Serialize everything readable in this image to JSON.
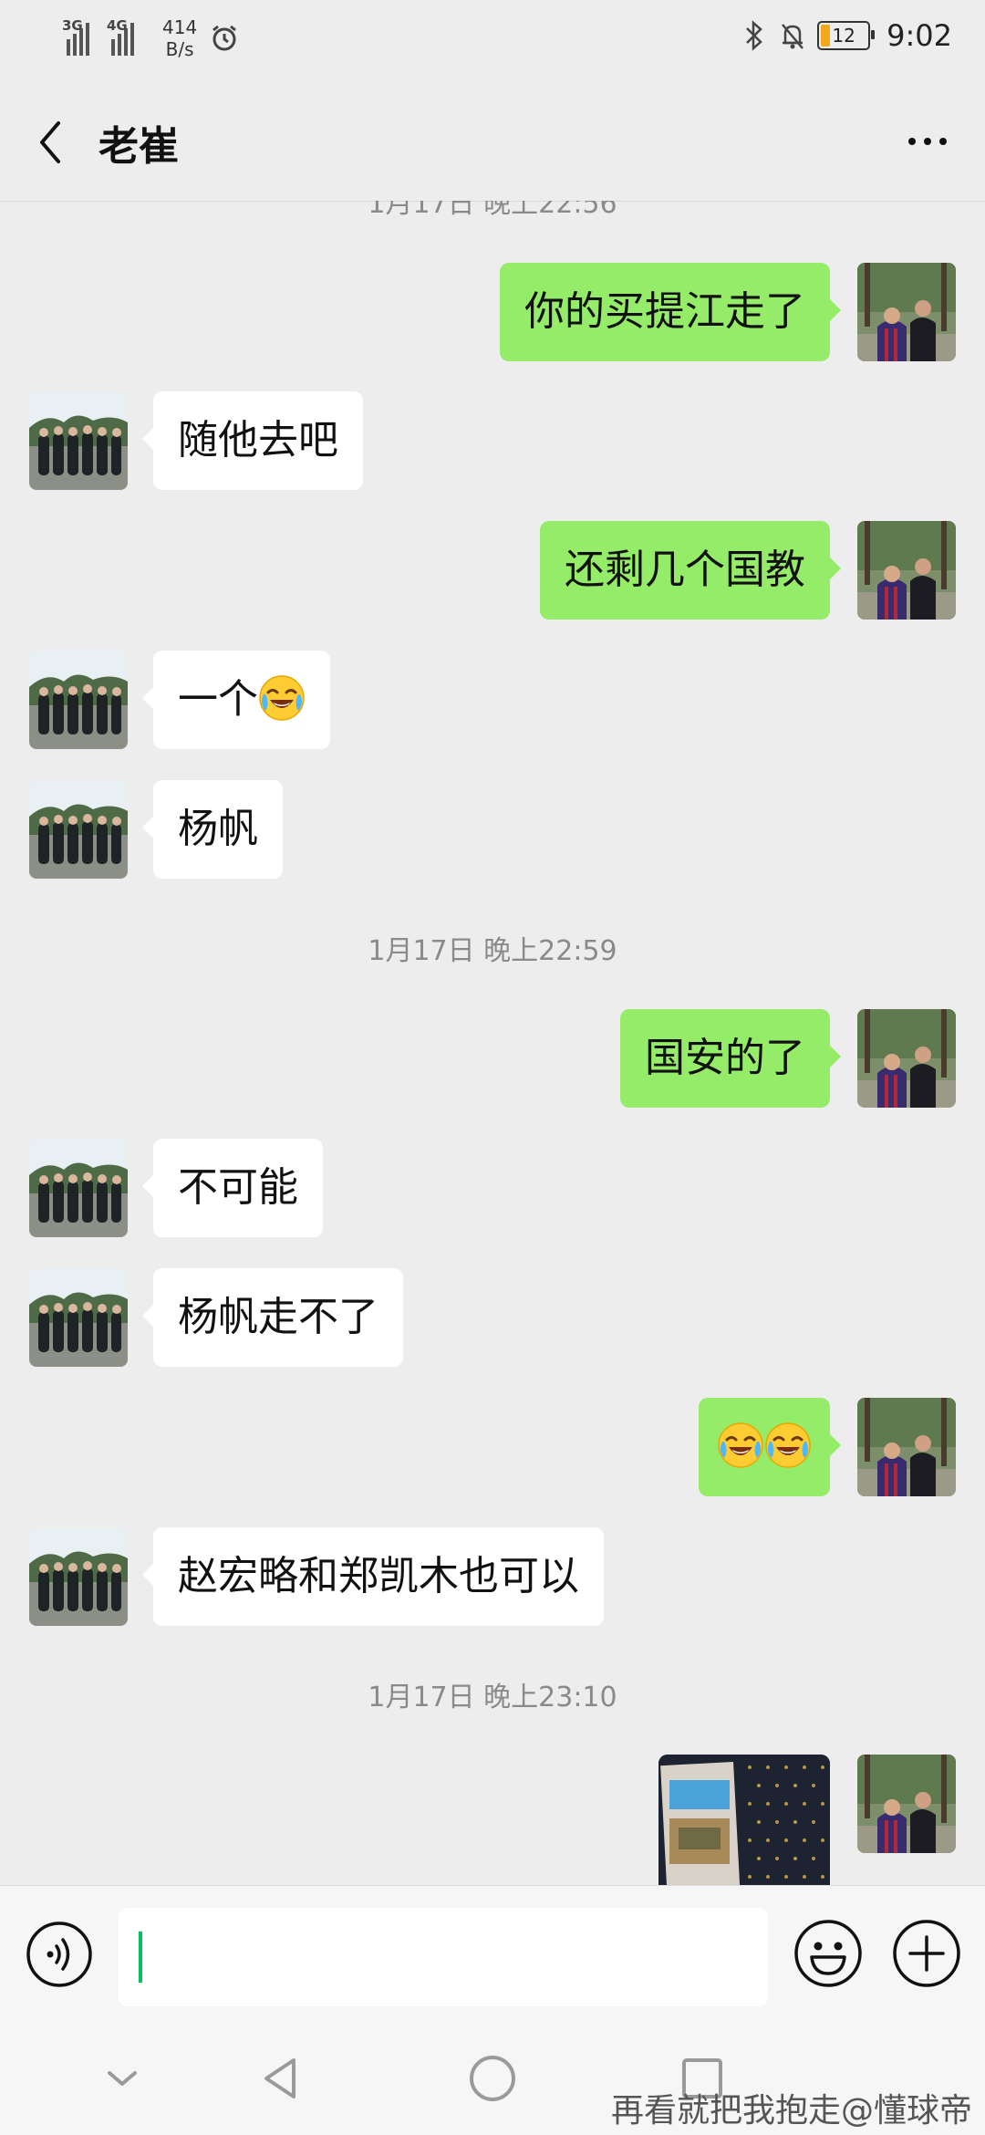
{
  "status_bar": {
    "net1": "3G",
    "net2": "4G",
    "speed_value": "414",
    "speed_unit": "B/s",
    "battery": "12",
    "time": "9:02"
  },
  "header": {
    "title": "老崔",
    "back_icon": "chevron-left-icon",
    "more_icon": "more-dots-icon"
  },
  "chat": {
    "top_timestamp_partial": "1月17日 晚上22:56",
    "messages": [
      {
        "from": "me",
        "text": "你的买提江走了"
      },
      {
        "from": "them",
        "text": "随他去吧"
      },
      {
        "from": "me",
        "text": "还剩几个国教"
      },
      {
        "from": "them",
        "text": "一个",
        "emoji": "laugh-cry-emoji"
      },
      {
        "from": "them",
        "text": "杨帆"
      },
      {
        "type": "timestamp",
        "text": "1月17日 晚上22:59"
      },
      {
        "from": "me",
        "text": "国安的了"
      },
      {
        "from": "them",
        "text": "不可能"
      },
      {
        "from": "them",
        "text": "杨帆走不了"
      },
      {
        "from": "me",
        "emoji": "laugh-cry-emoji x2"
      },
      {
        "from": "them",
        "text": "赵宏略和郑凯木也可以"
      },
      {
        "type": "timestamp",
        "text": "1月17日 晚上23:10"
      },
      {
        "from": "me",
        "type": "image"
      }
    ]
  },
  "input_bar": {
    "voice_icon": "voice-icon",
    "emoji_icon": "smile-icon",
    "plus_icon": "plus-icon"
  },
  "nav_bar": {
    "icons": [
      "chevron-down-icon",
      "back-triangle-icon",
      "home-circle-icon",
      "recents-square-icon"
    ],
    "watermark": "再看就把我抱走@懂球帝"
  },
  "colors": {
    "background": "#ededed",
    "outgoing_bubble": "#95ec69",
    "incoming_bubble": "#ffffff",
    "caret": "#07c160"
  }
}
